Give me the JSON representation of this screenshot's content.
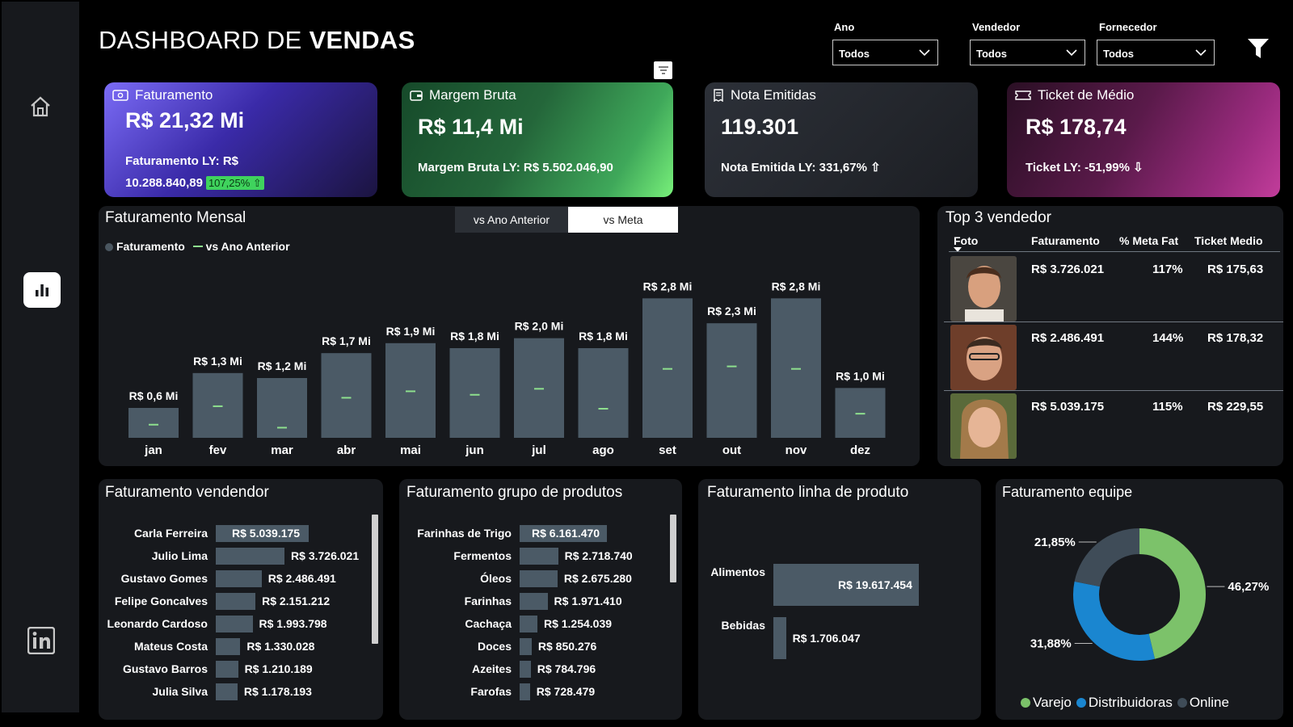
{
  "header": {
    "title_light": "DASHBOARD DE ",
    "title_bold": "VENDAS"
  },
  "filters": [
    {
      "label": "Ano",
      "value": "Todos"
    },
    {
      "label": "Vendedor",
      "value": "Todos"
    },
    {
      "label": "Fornecedor",
      "value": "Todos"
    }
  ],
  "sidebar": {
    "items": [
      {
        "icon": "home-icon"
      },
      {
        "icon": "bar-chart-icon",
        "active": true
      },
      {
        "icon": "linkedin-icon"
      }
    ]
  },
  "kpis": {
    "faturamento": {
      "label": "Faturamento",
      "value": "R$ 21,32 Mi",
      "ly_line1": "Faturamento LY: R$",
      "ly_line2": "10.288.840,89",
      "badge": "107,25% ⇧"
    },
    "margem": {
      "label": "Margem Bruta",
      "value": "R$ 11,4 Mi",
      "ly": "Margem Bruta LY: R$ 5.502.046,90"
    },
    "notas": {
      "label": "Nota Emitidas",
      "value": "119.301",
      "ly": "Nota Emitida LY: 331,67% ⇧"
    },
    "ticket": {
      "label": "Ticket de Médio",
      "value": "R$ 178,74",
      "ly": "Ticket LY: -51,99% ⇩"
    }
  },
  "monthly": {
    "title": "Faturamento Mensal",
    "toggle": [
      "vs Ano Anterior",
      "vs Meta"
    ],
    "legend": [
      "Faturamento",
      "vs Ano Anterior"
    ],
    "chart_data": {
      "type": "bar",
      "categories": [
        "jan",
        "fev",
        "mar",
        "abr",
        "mai",
        "jun",
        "jul",
        "ago",
        "set",
        "out",
        "nov",
        "dez"
      ],
      "series": [
        {
          "name": "Faturamento",
          "values": [
            0.6,
            1.3,
            1.2,
            1.7,
            1.9,
            1.8,
            2.0,
            1.8,
            2.8,
            2.3,
            2.8,
            1.0
          ]
        },
        {
          "name": "vs Ano Anterior",
          "values": [
            0.28,
            0.65,
            0.22,
            0.82,
            0.95,
            0.88,
            1.0,
            0.6,
            1.4,
            1.45,
            1.4,
            0.5
          ]
        }
      ],
      "data_labels": [
        "R$ 0,6 Mi",
        "R$ 1,3 Mi",
        "R$ 1,2 Mi",
        "R$ 1,7 Mi",
        "R$ 1,9 Mi",
        "R$ 1,8 Mi",
        "R$ 2,0 Mi",
        "R$ 1,8 Mi",
        "R$ 2,8 Mi",
        "R$ 2,3 Mi",
        "R$ 2,8 Mi",
        "R$ 1,0 Mi"
      ],
      "ylim": [
        0,
        3.0
      ],
      "colors": {
        "bar": "#4b5a66",
        "marker": "#8ee08e"
      }
    }
  },
  "top3": {
    "title": "Top 3 vendedor",
    "headers": [
      "Foto",
      "Faturamento",
      "% Meta Fat",
      "Ticket Medio"
    ],
    "rows": [
      {
        "faturamento": "R$ 3.726.021",
        "meta": "117%",
        "ticket": "R$ 175,63"
      },
      {
        "faturamento": "R$ 2.486.491",
        "meta": "144%",
        "ticket": "R$ 178,32"
      },
      {
        "faturamento": "R$ 5.039.175",
        "meta": "115%",
        "ticket": "R$ 229,55"
      }
    ]
  },
  "vendedor": {
    "title": "Faturamento vendendor",
    "chart_data": {
      "type": "bar",
      "orientation": "horizontal",
      "categories": [
        "Carla Ferreira",
        "Julio Lima",
        "Gustavo Gomes",
        "Felipe Goncalves",
        "Leonardo Cardoso",
        "Mateus Costa",
        "Gustavo Barros",
        "Julia Silva"
      ],
      "values": [
        5039175,
        3726021,
        2486491,
        2151212,
        1993798,
        1330028,
        1210189,
        1178193
      ],
      "data_labels": [
        "R$ 5.039.175",
        "R$ 3.726.021",
        "R$ 2.486.491",
        "R$ 2.151.212",
        "R$ 1.993.798",
        "R$ 1.330.028",
        "R$ 1.210.189",
        "R$ 1.178.193"
      ]
    }
  },
  "grupo": {
    "title": "Faturamento grupo de produtos",
    "chart_data": {
      "type": "bar",
      "orientation": "horizontal",
      "categories": [
        "Farinhas de Trigo",
        "Fermentos",
        "Óleos",
        "Farinhas",
        "Cachaça",
        "Doces",
        "Azeites",
        "Farofas"
      ],
      "values": [
        6161470,
        2718740,
        2675280,
        1971410,
        1254039,
        850276,
        784796,
        728479
      ],
      "data_labels": [
        "R$ 6.161.470",
        "R$ 2.718.740",
        "R$ 2.675.280",
        "R$ 1.971.410",
        "R$ 1.254.039",
        "R$ 850.276",
        "R$ 784.796",
        "R$ 728.479"
      ]
    }
  },
  "linha": {
    "title": "Faturamento linha de produto",
    "chart_data": {
      "type": "bar",
      "orientation": "horizontal",
      "categories": [
        "Alimentos",
        "Bebidas"
      ],
      "values": [
        19617454,
        1706047
      ],
      "data_labels": [
        "R$ 19.617.454",
        "R$ 1.706.047"
      ]
    }
  },
  "equipe": {
    "title": "Faturamento equipe",
    "chart_data": {
      "type": "pie",
      "donut": true,
      "categories": [
        "Varejo",
        "Distribuidoras",
        "Online"
      ],
      "values": [
        46.27,
        31.88,
        21.85
      ],
      "data_labels": [
        "46,27%",
        "31,88%",
        "21,85%"
      ],
      "colors": [
        "#7cc26a",
        "#1a86d0",
        "#3f4c58"
      ]
    }
  }
}
